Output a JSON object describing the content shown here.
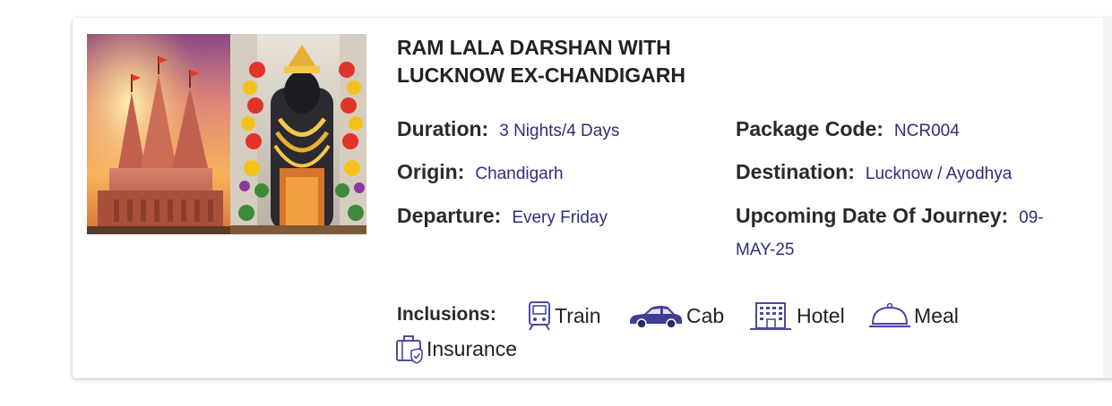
{
  "package": {
    "title": "RAM LALA DARSHAN WITH LUCKNOW EX-CHANDIGARH",
    "image_alt": "Ram Mandir and Ram Lala idol",
    "details": {
      "duration_label": "Duration:",
      "duration_value": "3 Nights/4 Days",
      "origin_label": "Origin:",
      "origin_value": "Chandigarh",
      "departure_label": "Departure:",
      "departure_value": "Every Friday",
      "package_code_label": "Package Code:",
      "package_code_value": "NCR004",
      "destination_label": "Destination:",
      "destination_value": "Lucknow / Ayodhya",
      "upcoming_label": "Upcoming Date Of Journey:",
      "upcoming_value_part1": "09-",
      "upcoming_value_part2": "MAY-25"
    },
    "inclusions": {
      "label": "Inclusions:",
      "items": [
        {
          "label": "Train",
          "icon": "train-icon"
        },
        {
          "label": "Cab",
          "icon": "car-icon"
        },
        {
          "label": "Hotel",
          "icon": "hotel-icon"
        },
        {
          "label": "Meal",
          "icon": "meal-cloche-icon"
        },
        {
          "label": "Insurance",
          "icon": "insurance-briefcase-icon"
        }
      ]
    }
  },
  "colors": {
    "value_text": "#2e2e7a",
    "icon_purple": "#4a4aa0",
    "heading_text": "#222222"
  }
}
